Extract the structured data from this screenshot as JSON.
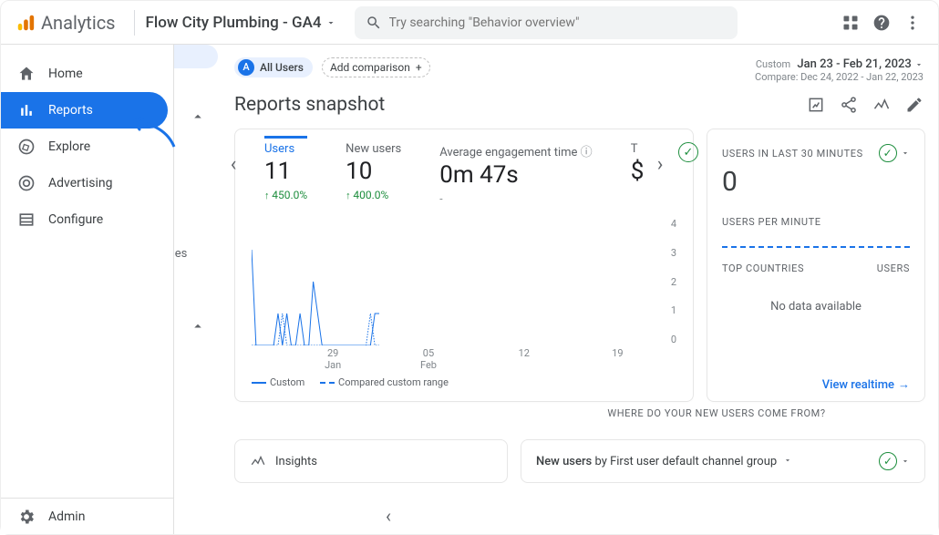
{
  "brand": "Analytics",
  "property": "Flow City Plumbing - GA4",
  "search": {
    "placeholder": "Try searching \"Behavior overview\""
  },
  "sidebar": {
    "items": [
      {
        "label": "Home"
      },
      {
        "label": "Reports"
      },
      {
        "label": "Explore"
      },
      {
        "label": "Advertising"
      },
      {
        "label": "Configure"
      }
    ],
    "admin": "Admin",
    "peek_text": "ses"
  },
  "pill": {
    "badge": "A",
    "label": "All Users"
  },
  "add_comparison": "Add comparison",
  "date": {
    "prefix": "Custom",
    "range": "Jan 23 - Feb 21, 2023",
    "compare": "Compare: Dec 24, 2022 - Jan 22, 2023"
  },
  "page_title": "Reports snapshot",
  "metrics": [
    {
      "label": "Users",
      "value": "11",
      "delta": "450.0%"
    },
    {
      "label": "New users",
      "value": "10",
      "delta": "400.0%"
    },
    {
      "label": "Average engagement time",
      "value": "0m 47s",
      "delta": "-"
    },
    {
      "label": "T",
      "value": "$",
      "delta": ""
    }
  ],
  "chart_data": {
    "type": "line",
    "ylim": [
      0,
      4
    ],
    "yticks": [
      4,
      3,
      2,
      1,
      0
    ],
    "x": [
      0,
      1,
      2,
      3,
      4,
      5,
      6,
      7,
      8,
      9,
      10,
      11,
      12,
      13,
      14,
      15,
      16,
      17,
      18,
      19,
      20,
      21,
      22,
      23,
      24,
      25,
      26,
      27,
      28,
      29
    ],
    "xtick_positions_pct": [
      20,
      43.5,
      67,
      90
    ],
    "xtick_labels_top": [
      "29",
      "05",
      "12",
      "19"
    ],
    "xtick_labels_bottom": [
      "Jan",
      "Feb",
      "",
      ""
    ],
    "series": [
      {
        "name": "Custom",
        "style": "solid",
        "values": [
          3,
          0,
          0,
          0,
          0,
          0,
          1,
          0,
          1,
          0,
          0,
          1,
          0,
          0,
          2,
          1,
          0,
          0,
          0,
          0,
          0,
          0,
          0,
          0,
          0,
          0,
          0,
          0,
          1,
          1
        ]
      },
      {
        "name": "Compared custom range",
        "style": "dashed",
        "values": [
          0,
          0,
          0,
          0,
          0,
          0,
          0,
          1,
          0,
          0,
          0,
          0,
          0,
          0,
          0,
          0,
          0,
          0,
          0,
          0,
          0,
          0,
          0,
          0,
          0,
          0,
          0,
          1,
          0,
          0
        ]
      }
    ],
    "legend": [
      "Custom",
      "Compared custom range"
    ]
  },
  "side_card": {
    "title": "USERS IN LAST 30 MINUTES",
    "value": "0",
    "sub": "USERS PER MINUTE",
    "col_left": "TOP COUNTRIES",
    "col_right": "USERS",
    "empty": "No data available",
    "link": "View realtime"
  },
  "lower": {
    "question": "WHERE DO YOUR NEW USERS COME FROM?",
    "insights": "Insights",
    "new_users": {
      "strong": "New users",
      "rest": " by First user default channel group"
    }
  }
}
